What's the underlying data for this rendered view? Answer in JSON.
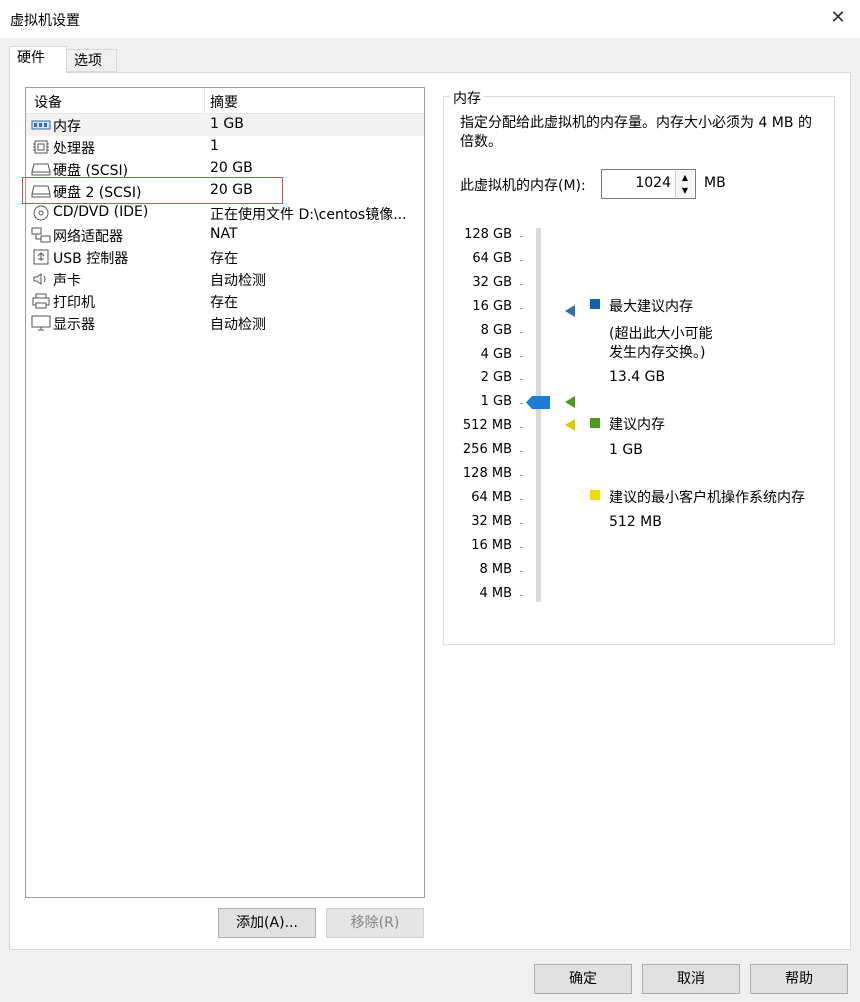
{
  "window": {
    "title": "虚拟机设置",
    "close_glyph": "✕"
  },
  "tabs": [
    {
      "label": "硬件"
    },
    {
      "label": "选项"
    }
  ],
  "device_list": {
    "header": {
      "device": "设备",
      "summary": "摘要"
    },
    "rows": [
      {
        "name": "内存",
        "summary": "1 GB",
        "icon": "memory-icon"
      },
      {
        "name": "处理器",
        "summary": "1",
        "icon": "processor-icon"
      },
      {
        "name": "硬盘 (SCSI)",
        "summary": "20 GB",
        "icon": "hard-disk-icon"
      },
      {
        "name": "硬盘 2 (SCSI)",
        "summary": "20 GB",
        "icon": "hard-disk-icon"
      },
      {
        "name": "CD/DVD (IDE)",
        "summary": "正在使用文件 D:\\centos镜像...",
        "icon": "cd-dvd-icon"
      },
      {
        "name": "网络适配器",
        "summary": "NAT",
        "icon": "network-adapter-icon"
      },
      {
        "name": "USB 控制器",
        "summary": "存在",
        "icon": "usb-icon"
      },
      {
        "name": "声卡",
        "summary": "自动检测",
        "icon": "speaker-icon"
      },
      {
        "name": "打印机",
        "summary": "存在",
        "icon": "printer-icon"
      },
      {
        "name": "显示器",
        "summary": "自动检测",
        "icon": "display-icon"
      }
    ]
  },
  "list_buttons": {
    "add": "添加(A)...",
    "remove": "移除(R)"
  },
  "memory": {
    "group_title": "内存",
    "description": "指定分配给此虚拟机的内存量。内存大小必须为 4 MB 的倍数。",
    "field_label": "此虚拟机的内存(M):",
    "value": "1024",
    "unit": "MB",
    "scale": [
      "128 GB",
      "64 GB",
      "32 GB",
      "16 GB",
      "8 GB",
      "4 GB",
      "2 GB",
      "1 GB",
      "512 MB",
      "256 MB",
      "128 MB",
      "64 MB",
      "32 MB",
      "16 MB",
      "8 MB",
      "4 MB"
    ],
    "current_level": "1 GB",
    "legend": {
      "max": {
        "label": "最大建议内存",
        "note_line1": "(超出此大小可能",
        "note_line2": "发生内存交换。)",
        "value": "13.4 GB"
      },
      "recommended": {
        "label": "建议内存",
        "value": "1 GB"
      },
      "minimum": {
        "label": "建议的最小客户机操作系统内存",
        "value": "512 MB"
      }
    },
    "colors": {
      "max": "#0f62a8",
      "recommended": "#4e9a1a",
      "minimum": "#f5d800",
      "thumb": "#1a7fd4"
    }
  },
  "footer_buttons": {
    "ok": "确定",
    "cancel": "取消",
    "help": "帮助"
  }
}
